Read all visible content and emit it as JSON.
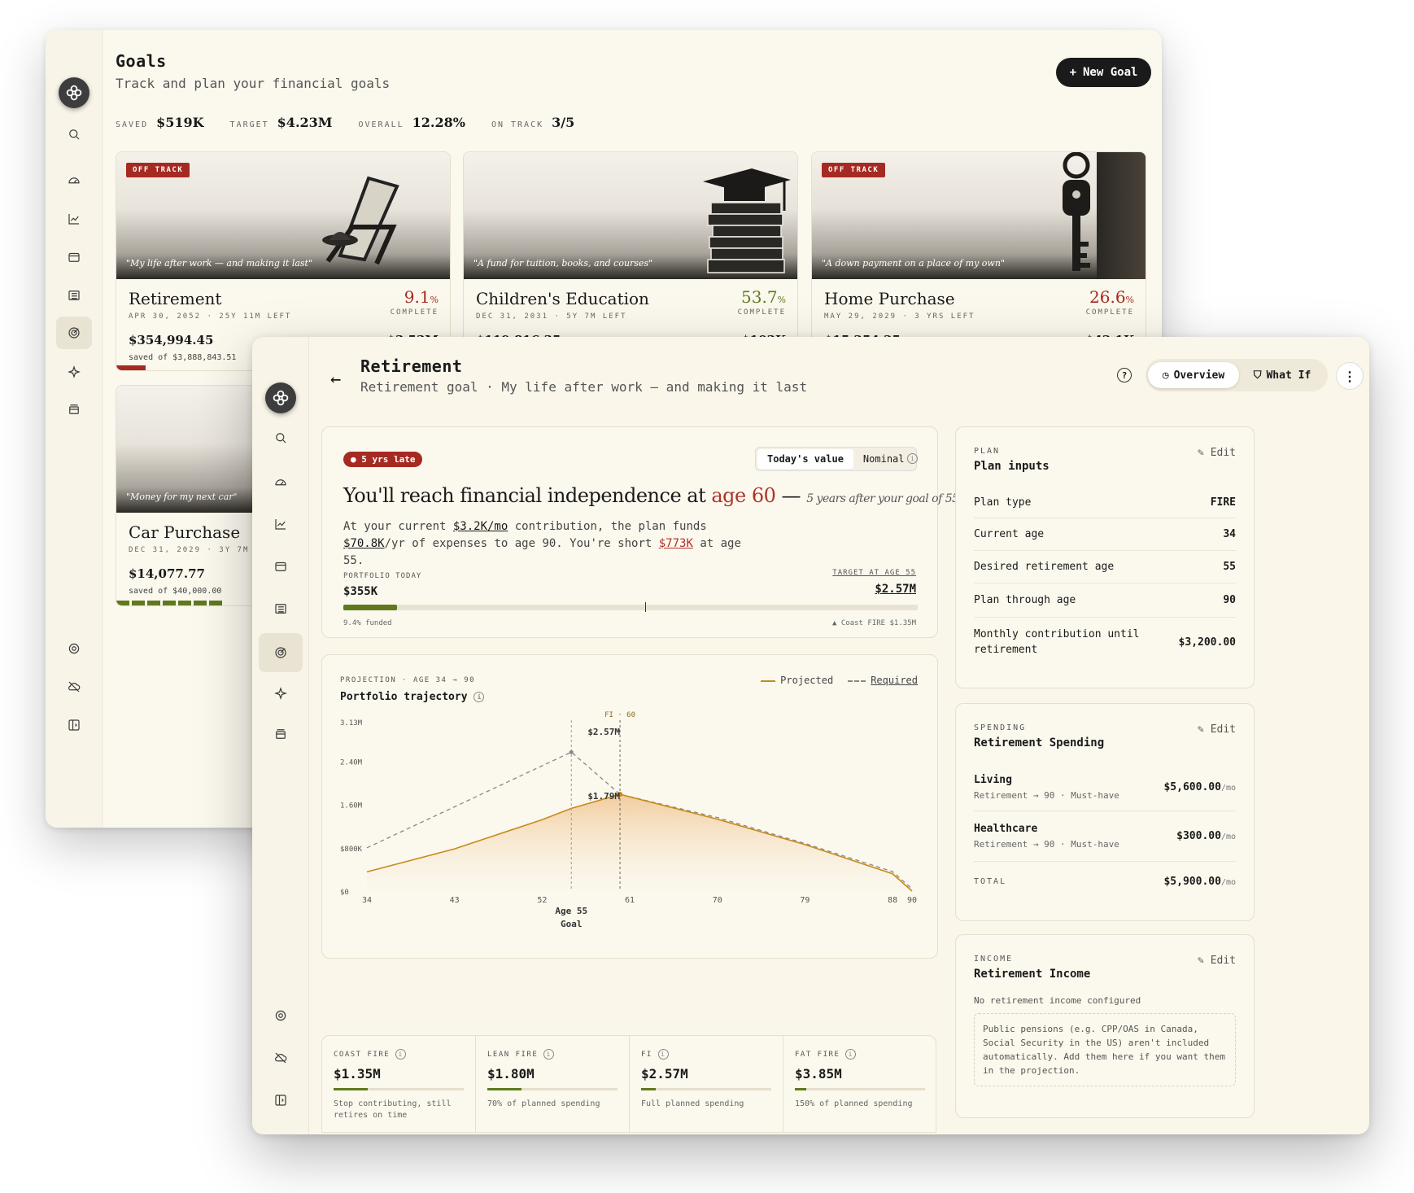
{
  "goals_window": {
    "title": "Goals",
    "subtitle": "Track and plan your financial goals",
    "new_goal_label": "New Goal",
    "stats": [
      {
        "label": "SAVED",
        "value": "$519K"
      },
      {
        "label": "TARGET",
        "value": "$4.23M"
      },
      {
        "label": "OVERALL",
        "value": "12.28%"
      },
      {
        "label": "ON TRACK",
        "value": "3/5"
      }
    ],
    "cards": [
      {
        "badge": "OFF TRACK",
        "quote": "\"My life after work — and making it last\"",
        "name": "Retirement",
        "pct": "9.1",
        "pct_unit": "%",
        "complete": "COMPLETE",
        "meta": "APR 30, 2052 · 25Y 11M LEFT",
        "saved": "$354,994.45",
        "target": "$3.53M",
        "of": "saved of $3,888,843.51",
        "pct_color": "#a52a22"
      },
      {
        "badge": "",
        "quote": "\"A fund for tuition, books, and courses\"",
        "name": "Children's Education",
        "pct": "53.7",
        "pct_unit": "%",
        "complete": "COMPLETE",
        "meta": "DEC 31, 2031 · 5Y 7M LEFT",
        "saved": "$119,816.35",
        "target": "$103K",
        "pct_color": "#5f7a1c"
      },
      {
        "badge": "OFF TRACK",
        "quote": "\"A down payment on a place of my own\"",
        "name": "Home Purchase",
        "pct": "26.6",
        "pct_unit": "%",
        "complete": "COMPLETE",
        "meta": "MAY 29, 2029 · 3 YRS LEFT",
        "saved": "$15,254.25",
        "target": "$42.1K",
        "pct_color": "#a52a22"
      },
      {
        "badge": "",
        "quote": "\"Money for my next car\"",
        "name": "Car Purchase",
        "meta": "DEC 31, 2029 · 3Y 7M LE",
        "saved": "$14,077.77",
        "of": "saved of $40,000.00"
      }
    ]
  },
  "detail": {
    "title": "Retirement",
    "subtitle": "Retirement goal · My life after work — and making it last",
    "help": "?",
    "tabs": {
      "overview": "Overview",
      "whatif": "What If"
    },
    "late_badge": "5 yrs late",
    "toggle": {
      "today": "Today's value",
      "nominal": "Nominal"
    },
    "headline": {
      "pre": "You'll reach financial independence at ",
      "age": "age 60",
      "dash": " — ",
      "note": "5 years after your goal of 55."
    },
    "para": {
      "a": "At your current ",
      "contrib": "$3.2K/mo",
      "b": " contribution, the plan funds ",
      "funds": "$70.8K",
      "c": "/yr of expenses to age 90. You're short ",
      "short": "$773K",
      "d": " at age 55."
    },
    "portfolio_label": "PORTFOLIO TODAY",
    "portfolio_value": "$355K",
    "target_label": "TARGET AT AGE 55",
    "target_value": "$2.57M",
    "funded_fraction": 0.094,
    "funded_text": "9.4% funded",
    "coast_text": "▲ Coast FIRE $1.35M",
    "projection_label": "PROJECTION · AGE 34 → 90",
    "projection_title": "Portfolio trajectory",
    "legend": {
      "projected": "Projected",
      "required": "Required"
    },
    "fire": [
      {
        "label": "COAST FIRE",
        "value": "$1.35M",
        "desc": "Stop contributing, still retires on time"
      },
      {
        "label": "LEAN FIRE",
        "value": "$1.80M",
        "desc": "70% of planned spending"
      },
      {
        "label": "FI",
        "value": "$2.57M",
        "desc": "Full planned spending"
      },
      {
        "label": "FAT FIRE",
        "value": "$3.85M",
        "desc": "150% of planned spending"
      }
    ],
    "plan": {
      "label": "PLAN",
      "title": "Plan inputs",
      "edit": "Edit",
      "rows": [
        {
          "k": "Plan type",
          "v": "FIRE"
        },
        {
          "k": "Current age",
          "v": "34"
        },
        {
          "k": "Desired retirement age",
          "v": "55"
        },
        {
          "k": "Plan through age",
          "v": "90"
        },
        {
          "k": "Monthly contribution until retirement",
          "v": "$3,200.00"
        }
      ]
    },
    "spending": {
      "label": "SPENDING",
      "title": "Retirement Spending",
      "edit": "Edit",
      "items": [
        {
          "name": "Living",
          "sub": "Retirement → 90 · Must-have",
          "amt": "$5,600.00",
          "unit": "/mo"
        },
        {
          "name": "Healthcare",
          "sub": "Retirement → 90 · Must-have",
          "amt": "$300.00",
          "unit": "/mo"
        }
      ],
      "total_label": "TOTAL",
      "total": "$5,900.00",
      "total_unit": "/mo"
    },
    "income": {
      "label": "INCOME",
      "title": "Retirement Income",
      "edit": "Edit",
      "none": "No retirement income configured",
      "note": "Public pensions (e.g. CPP/OAS in Canada, Social Security in the US) aren't included automatically. Add them here if you want them in the projection."
    }
  },
  "chart_data": {
    "type": "area",
    "x": [
      34,
      43,
      52,
      55,
      60,
      61,
      70,
      79,
      88,
      90
    ],
    "xticks": [
      "34",
      "43",
      "52",
      "61",
      "70",
      "79",
      "88",
      "90"
    ],
    "yticks": [
      "$0",
      "$800K",
      "1.60M",
      "2.40M",
      "3.13M"
    ],
    "ylim": [
      0,
      3130000
    ],
    "xlim": [
      34,
      90
    ],
    "series": [
      {
        "name": "Projected",
        "x": [
          34,
          43,
          52,
          55,
          60,
          70,
          79,
          88,
          90
        ],
        "values": [
          355000,
          780000,
          1320000,
          1530000,
          1790000,
          1330000,
          860000,
          320000,
          0
        ],
        "color": "#c88a1a",
        "style": "solid"
      },
      {
        "name": "Required",
        "x": [
          34,
          55,
          60,
          70,
          79,
          88,
          90
        ],
        "values": [
          800000,
          2570000,
          1790000,
          1360000,
          880000,
          360000,
          40000
        ],
        "color": "#888888",
        "style": "dashed"
      }
    ],
    "annotations": {
      "fi_marker": "FI · 60",
      "fi_value": "$1.79M",
      "goal_value": "$2.57M",
      "goal_label": "Age 55",
      "goal_sub": "Goal"
    },
    "grid": false,
    "legend_position": "top-right"
  }
}
